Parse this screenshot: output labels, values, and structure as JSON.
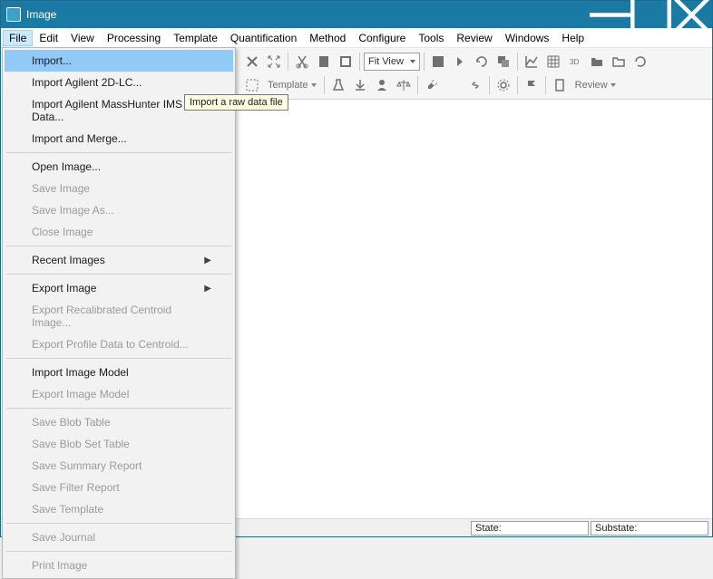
{
  "window": {
    "title": "Image"
  },
  "menubar": [
    "File",
    "Edit",
    "View",
    "Processing",
    "Template",
    "Quantification",
    "Method",
    "Configure",
    "Tools",
    "Review",
    "Windows",
    "Help"
  ],
  "toolbar": {
    "fitview": "Fit View",
    "template_label": "Template",
    "review_label": "Review"
  },
  "file_menu": {
    "items": [
      {
        "label": "Import...",
        "enabled": true,
        "highlight": true
      },
      {
        "label": "Import Agilent 2D-LC...",
        "enabled": true
      },
      {
        "label": "Import Agilent MassHunter IMS Data...",
        "enabled": true
      },
      {
        "label": "Import and Merge...",
        "enabled": true
      },
      {
        "sep": true
      },
      {
        "label": "Open Image...",
        "enabled": true
      },
      {
        "label": "Save Image",
        "enabled": false
      },
      {
        "label": "Save Image As...",
        "enabled": false
      },
      {
        "label": "Close Image",
        "enabled": false
      },
      {
        "sep": true
      },
      {
        "label": "Recent Images",
        "enabled": true,
        "submenu": true
      },
      {
        "sep": true
      },
      {
        "label": "Export Image",
        "enabled": true,
        "submenu": true
      },
      {
        "label": "Export Recalibrated Centroid Image...",
        "enabled": false
      },
      {
        "label": "Export Profile Data to Centroid...",
        "enabled": false
      },
      {
        "sep": true
      },
      {
        "label": "Import Image Model",
        "enabled": true
      },
      {
        "label": "Export Image Model",
        "enabled": false
      },
      {
        "sep": true
      },
      {
        "label": "Save Blob Table",
        "enabled": false
      },
      {
        "label": "Save Blob Set Table",
        "enabled": false
      },
      {
        "label": "Save Summary Report",
        "enabled": false
      },
      {
        "label": "Save Filter Report",
        "enabled": false
      },
      {
        "label": "Save Template",
        "enabled": false
      },
      {
        "sep": true
      },
      {
        "label": "Save Journal",
        "enabled": false
      },
      {
        "sep": true
      },
      {
        "label": "Print Image",
        "enabled": false
      }
    ]
  },
  "tooltip": "Import a raw data file",
  "status": {
    "state_label": "State:",
    "substate_label": "Substate:"
  }
}
